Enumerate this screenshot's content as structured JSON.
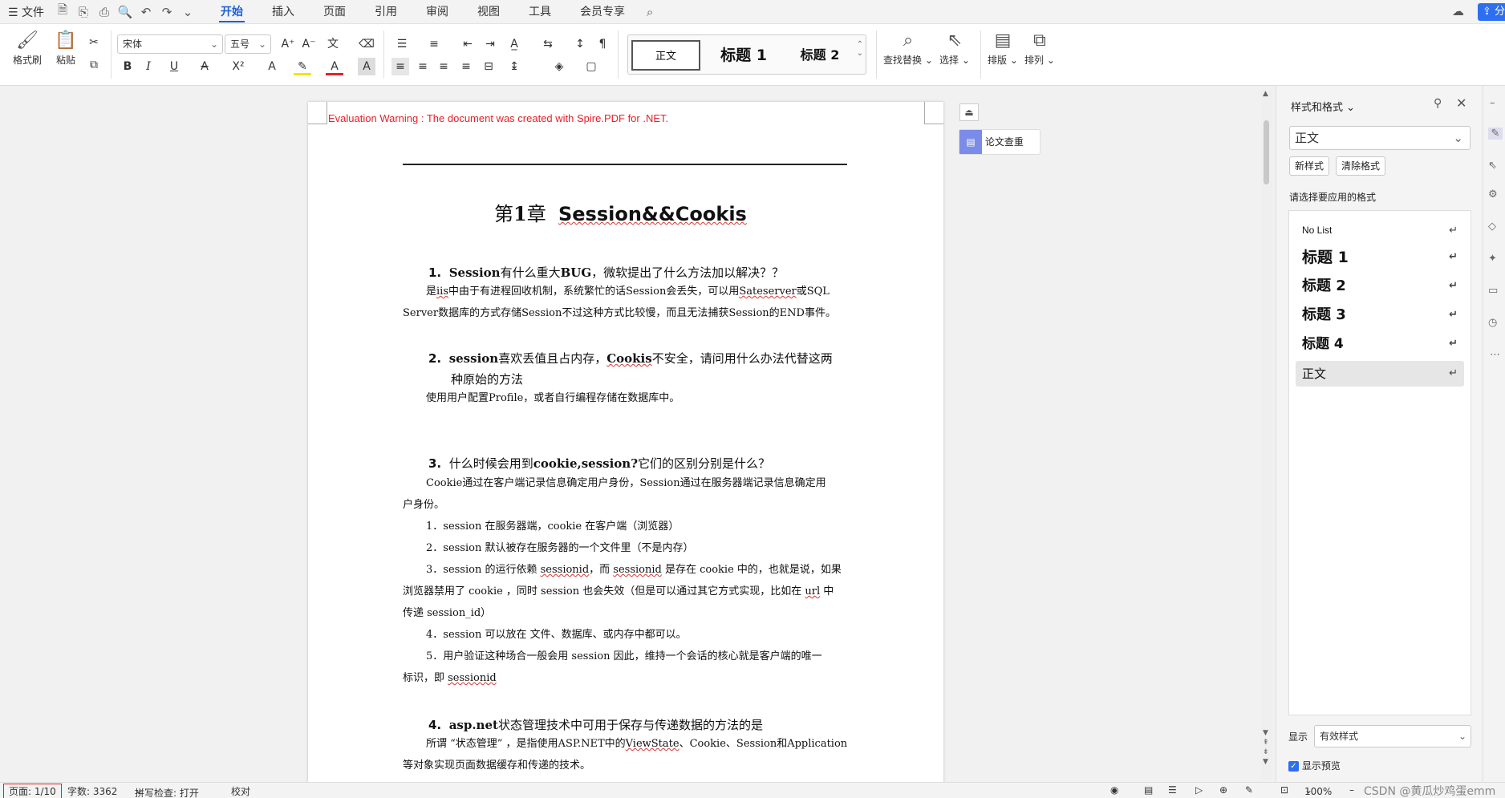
{
  "menubar": {
    "file_label": "文件",
    "tabs": [
      "开始",
      "插入",
      "页面",
      "引用",
      "审阅",
      "视图",
      "工具",
      "会员专享"
    ],
    "share_label": "分"
  },
  "ribbon": {
    "format_painter": "格式刷",
    "paste": "粘贴",
    "font_name": "宋体",
    "font_size": "五号",
    "styles": [
      "正文",
      "标题 1",
      "标题 2"
    ],
    "find_replace": "查找替换",
    "select": "选择",
    "layout": "排版",
    "arrange": "排列"
  },
  "side_tool": {
    "paper_check": "论文查重"
  },
  "document": {
    "warning": "Evaluation Warning : The document was created with Spire.PDF for .NET.",
    "title_prefix": "第",
    "title_num": "1",
    "title_mid": "章",
    "title_text": "Session&&Cookis",
    "q1_num": "1.",
    "q1_bold": "Session",
    "q1_text_a": "有什么重大",
    "q1_bold2": "BUG",
    "q1_text_b": "，微软提出了什么方法加以解决？？",
    "a1_l1a": "是",
    "a1_l1_iis": "iis",
    "a1_l1b": "中由于有进程回收机制，系统繁忙的话Session会丢失，可以用",
    "a1_l1_state": "Sateserver",
    "a1_l1c": "或SQL",
    "a1_l2": "Server数据库的方式存储Session不过这种方式比较慢，而且无法捕获Session的END事件。",
    "q2_num": "2.",
    "q2_bold": "session",
    "q2_text_a": "喜欢丢值且占内存，",
    "q2_bold2": "Cookis",
    "q2_text_b": "不安全，请问用什么办法代替这两",
    "q2_l2": "种原始的方法",
    "a2": "使用用户配置Profile，或者自行编程存储在数据库中。",
    "q3_num": "3.",
    "q3_text_a": "什么时候会用到",
    "q3_bold": "cookie,session?",
    "q3_text_b": "它们的区别分别是什么？",
    "a3_l1": "Cookie通过在客户端记录信息确定用户身份，Session通过在服务器端记录信息确定用",
    "a3_l2": "户身份。",
    "a3_i1": "1．session 在服务器端，cookie  在客户端（浏览器）",
    "a3_i2": "2．session  默认被存在服务器的一个文件里（不是内存）",
    "a3_i3a": "3．session 的运行依赖 ",
    "a3_i3_sid": "sessionid",
    "a3_i3b": "，而 ",
    "a3_i3_sid2": "sessionid",
    "a3_i3c": " 是存在 cookie  中的，也就是说，如果",
    "a3_i3_l2a": "浏览器禁用了 cookie ，同时 session 也会失效（但是可以通过其它方式实现，比如在 ",
    "a3_i3_url": "url",
    "a3_i3_l2b": " 中",
    "a3_i3_l3": "传递 session_id）",
    "a3_i4": "4．session 可以放在 文件、数据库、或内存中都可以。",
    "a3_i5": "5．用户验证这种场合一般会用 session  因此，维持一个会话的核心就是客户端的唯一",
    "a3_i5_l2a": "标识，即 ",
    "a3_i5_sid": "sessionid",
    "q4_num": "4.",
    "q4_bold": "asp.net",
    "q4_text": "状态管理技术中可用于保存与传递数据的方法的是",
    "a4_l1a": "所谓 “状态管理” ，是指使用ASP.NET中的",
    "a4_l1_vs": "ViewState",
    "a4_l1b": "、Cookie、Session和Application",
    "a4_l2": "等对象实现页面数据缓存和传递的技术。"
  },
  "panel": {
    "title": "样式和格式",
    "current_style": "正文",
    "new_style": "新样式",
    "clear_format": "清除格式",
    "prompt": "请选择要应用的格式",
    "items": [
      "No List",
      "标题 1",
      "标题 2",
      "标题 3",
      "标题 4",
      "正文"
    ],
    "show_label": "显示",
    "show_value": "有效样式",
    "preview_label": "显示预览"
  },
  "status": {
    "page": "页面: 1/10",
    "words": "字数: 3362",
    "spell": "拼写检查: 打开",
    "proof": "校对",
    "zoom": "100%",
    "watermark": "CSDN @黄瓜炒鸡蛋emm"
  },
  "colors": {
    "accent": "#1d5fd6",
    "warning": "#e8202a",
    "status_highlight": "#e02020"
  }
}
